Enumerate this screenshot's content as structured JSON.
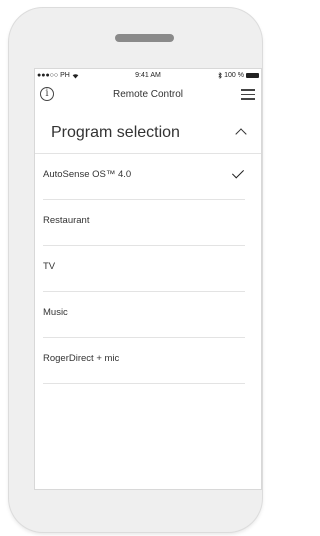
{
  "status_bar": {
    "carrier": "●●●○○ PH",
    "wifi_icon": "wifi-icon",
    "time": "9:41 AM",
    "bluetooth_icon": "bluetooth-icon",
    "battery_text": "100 %"
  },
  "nav": {
    "title": "Remote Control",
    "info_icon": "info-icon",
    "info_glyph": "i",
    "menu_icon": "hamburger-menu-icon"
  },
  "section": {
    "title": "Program selection",
    "expanded": true
  },
  "programs": [
    {
      "label": "AutoSense OS™ 4.0",
      "selected": true
    },
    {
      "label": "Restaurant",
      "selected": false
    },
    {
      "label": "TV",
      "selected": false
    },
    {
      "label": "Music",
      "selected": false
    },
    {
      "label": "RogerDirect + mic",
      "selected": false
    }
  ]
}
